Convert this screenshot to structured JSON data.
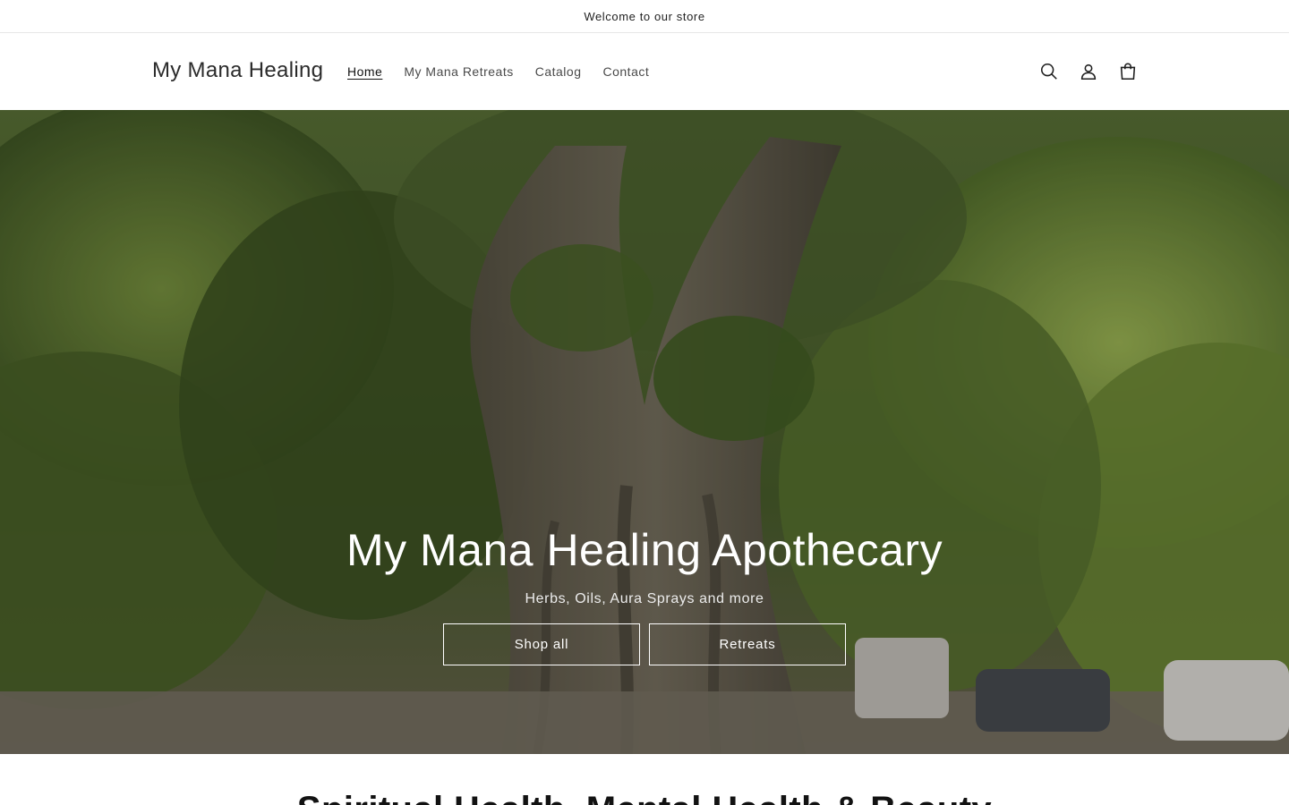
{
  "announcement": {
    "text": "Welcome to our store"
  },
  "header": {
    "logo": "My Mana Healing",
    "nav": [
      {
        "label": "Home",
        "active": true
      },
      {
        "label": "My Mana Retreats",
        "active": false
      },
      {
        "label": "Catalog",
        "active": false
      },
      {
        "label": "Contact",
        "active": false
      }
    ],
    "icons": [
      "search-icon",
      "account-icon",
      "cart-icon"
    ]
  },
  "hero": {
    "title": "My Mana Healing Apothecary",
    "subtitle": "Herbs, Oils, Aura Sprays and more",
    "buttons": [
      {
        "label": "Shop all"
      },
      {
        "label": "Retreats"
      }
    ],
    "overlay_color": "#000000"
  },
  "next_section": {
    "heading": "Spiritual Health, Mental Health & Beauty"
  }
}
